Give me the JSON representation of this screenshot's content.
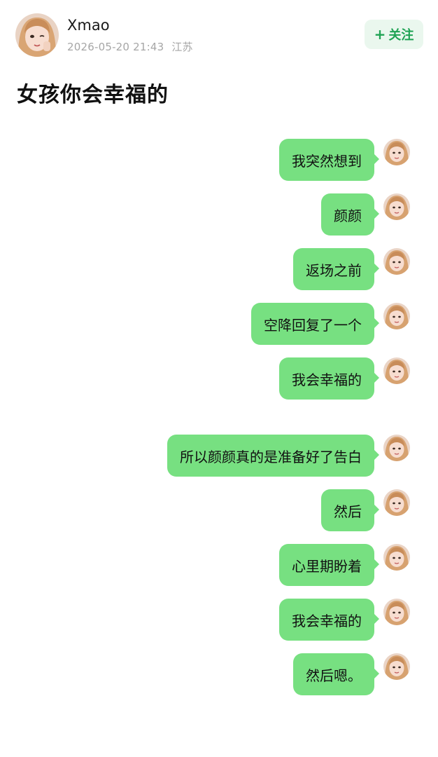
{
  "author": {
    "name": "Xmao",
    "date": "2026-05-20 21:43",
    "location": "江苏",
    "avatar_icon": "user-avatar-icon"
  },
  "follow": {
    "icon": "+",
    "label": "关注",
    "color": "#1fa354",
    "bg": "#eaf7ee"
  },
  "post": {
    "title": "女孩你会幸福的"
  },
  "chat": {
    "bubble_color": "#77e081",
    "messages": [
      {
        "text": "我突然想到"
      },
      {
        "text": "颜颜"
      },
      {
        "text": "返场之前"
      },
      {
        "text": "空降回复了一个"
      },
      {
        "text": "我会幸福的"
      },
      {
        "text": "所以颜颜真的是准备好了告白"
      },
      {
        "text": "然后"
      },
      {
        "text": "心里期盼着"
      },
      {
        "text": "我会幸福的"
      },
      {
        "text": "然后嗯。"
      }
    ]
  }
}
